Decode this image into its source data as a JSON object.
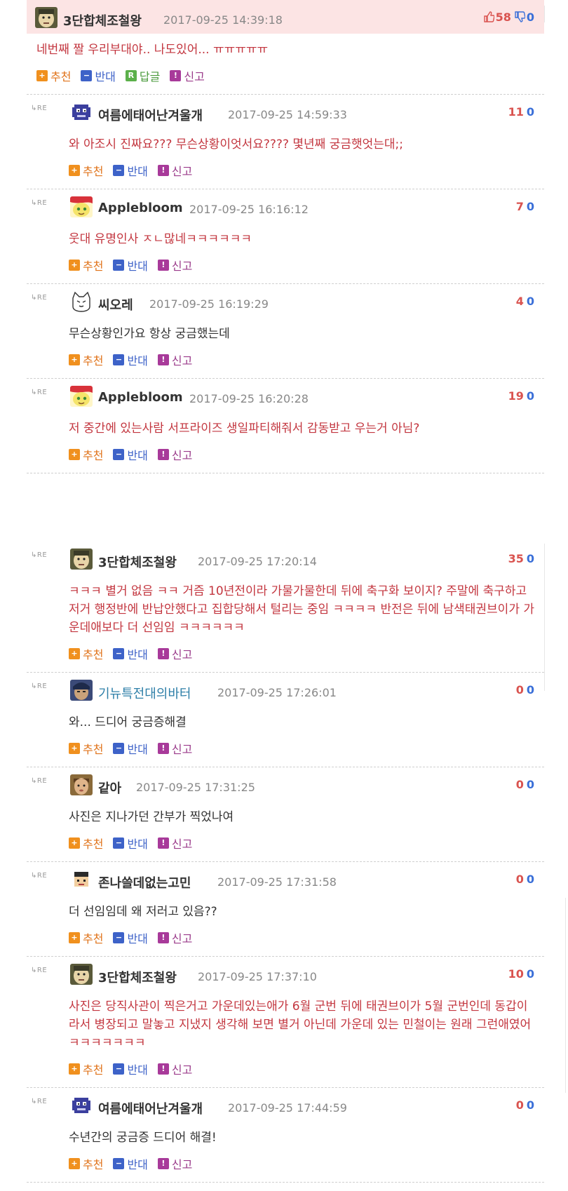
{
  "labels": {
    "recommend": "추천",
    "oppose": "반대",
    "answer": "답글",
    "report": "신고",
    "re": "RE"
  },
  "colors": {
    "top_bg": "#fce4e4",
    "comment_red": "#c3363f",
    "recommend": "#f0901e",
    "oppose": "#3d62c8",
    "answer": "#5bb04a",
    "report": "#a83a9a"
  },
  "comments": [
    {
      "nick": "3단합체조철왕",
      "date": "2017-09-25 14:39:18",
      "up": "58",
      "down": "0",
      "text": "네번째 짤 우리부대야.. 나도있어... ㅠㅠㅠㅠㅠ",
      "avatar": "default-face-icon"
    },
    {
      "nick": "여름에태어난겨울개",
      "date": "2017-09-25 14:59:33",
      "up": "11",
      "down": "0",
      "text": "와 아조시 진짜요??? 무슨상황이엇서요???? 몇년째 궁금햇엇는대;;",
      "avatar": "pixel-character-icon"
    },
    {
      "nick": "Applebloom",
      "date": "2017-09-25 16:16:12",
      "up": "7",
      "down": "0",
      "text": "웃대 유명인사 ㅈㄴ많네ㅋㅋㅋㅋㅋㅋ",
      "avatar": "pony-icon"
    },
    {
      "nick": "씨오레",
      "date": "2017-09-25 16:19:29",
      "up": "4",
      "down": "0",
      "text": "무슨상황인가요 항상 궁금했는데",
      "avatar": "cat-face-icon"
    },
    {
      "nick": "Applebloom",
      "date": "2017-09-25 16:20:28",
      "up": "19",
      "down": "0",
      "text": "저 중간에 있는사람 서프라이즈 생일파티해줘서 감동받고 우는거 아님?",
      "avatar": "pony-icon"
    },
    {
      "nick": "3단합체조철왕",
      "date": "2017-09-25 17:20:14",
      "up": "35",
      "down": "0",
      "text": "ㅋㅋㅋ 별거 없음 ㅋㅋ 거즘 10년전이라 가물가물한데 뒤에 축구화 보이지? 주말에 축구하고 저거 행정반에 반납안했다고 집합당해서 털리는 중임 ㅋㅋㅋㅋ 반전은 뒤에 남색태권브이가 가운데애보다 더 선임임 ㅋㅋㅋㅋㅋㅋ",
      "avatar": "default-face-icon"
    },
    {
      "nick": "기뉴특전대의바터",
      "date": "2017-09-25 17:26:01",
      "up": "0",
      "down": "0",
      "text": "와... 드디어 궁금증해결",
      "avatar": "anime-character-icon"
    },
    {
      "nick": "같아",
      "date": "2017-09-25 17:31:25",
      "up": "0",
      "down": "0",
      "text": "사진은 지나가던 간부가 찍었나여",
      "avatar": "photo-face-icon"
    },
    {
      "nick": "존나쓸데없는고민",
      "date": "2017-09-25 17:31:58",
      "up": "0",
      "down": "0",
      "text": "더 선임임데 왜 저러고 있음??",
      "avatar": "pixel-boy-icon"
    },
    {
      "nick": "3단합체조철왕",
      "date": "2017-09-25 17:37:10",
      "up": "10",
      "down": "0",
      "text": "사진은 당직사관이 찍은거고 가운데있는애가 6월 군번 뒤에 태권브이가 5월 군번인데 동갑이라서 병장되고 말놓고 지냈지 생각해 보면 별거 아닌데 가운데 있는 민철이는 원래 그런애였어 ㅋㅋㅋㅋㅋㅋㅋ",
      "avatar": "default-face-icon"
    },
    {
      "nick": "여름에태어난겨울개",
      "date": "2017-09-25 17:44:59",
      "up": "0",
      "down": "0",
      "text": "수년간의 궁금증 드디어 해결!",
      "avatar": "pixel-character-icon"
    }
  ]
}
